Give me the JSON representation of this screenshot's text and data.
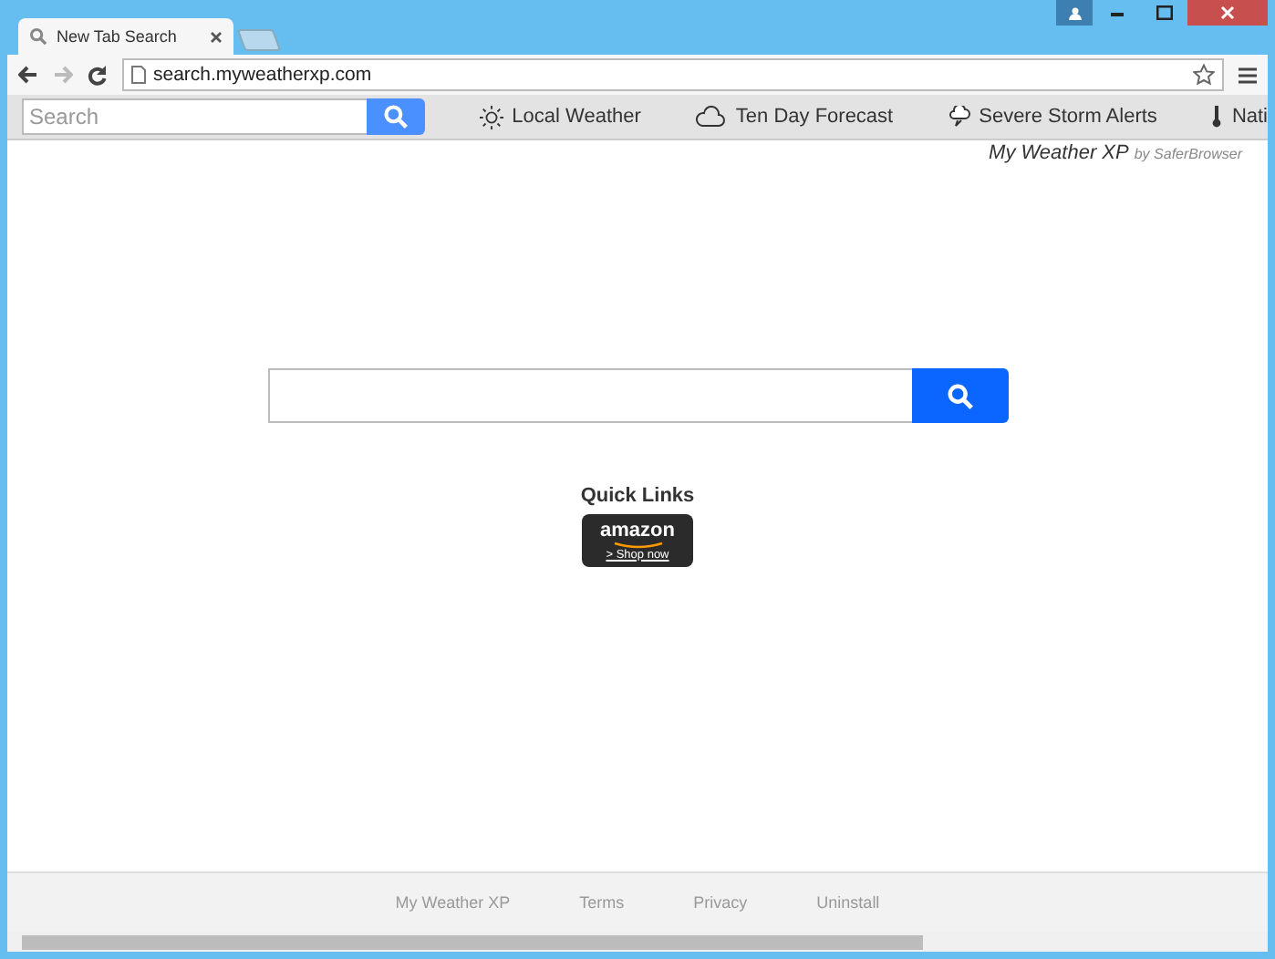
{
  "tabs": [
    {
      "title": "New Tab Search",
      "selected": true
    }
  ],
  "address": "search.myweatherxp.com",
  "toolbar": {
    "search_placeholder": "Search",
    "links": [
      {
        "kind": "sun",
        "label": "Local Weather"
      },
      {
        "kind": "cloud",
        "label": "Ten Day Forecast"
      },
      {
        "kind": "storm",
        "label": "Severe Storm Alerts"
      },
      {
        "kind": "thermometer",
        "label": "Nati"
      }
    ]
  },
  "brand": {
    "name": "My Weather XP",
    "by": "by SaferBrowser"
  },
  "quick_links": {
    "title": "Quick Links",
    "items": [
      {
        "logo": "amazon",
        "action": "> Shop now"
      }
    ]
  },
  "footer": [
    "My Weather XP",
    "Terms",
    "Privacy",
    "Uninstall"
  ]
}
